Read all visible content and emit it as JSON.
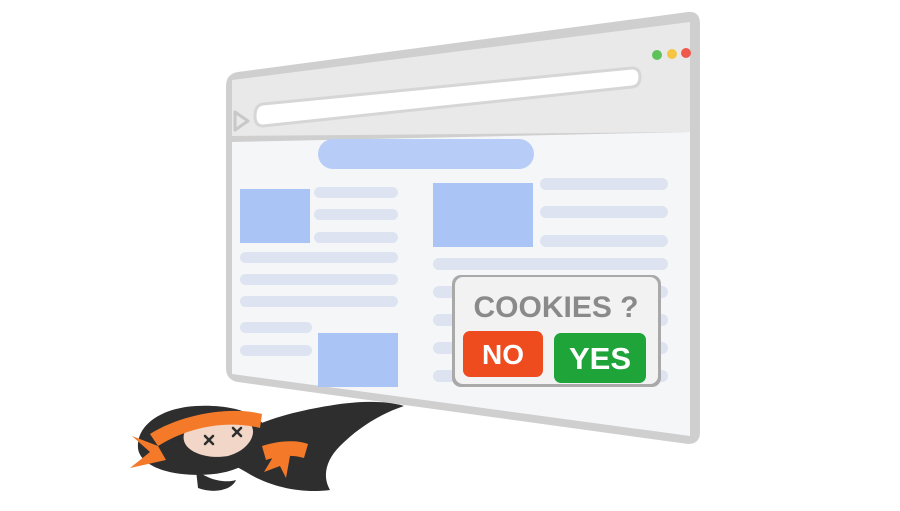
{
  "browser": {
    "window_controls": [
      "green",
      "yellow",
      "red"
    ],
    "control_colors": {
      "green": "#5ec25a",
      "yellow": "#f5c542",
      "red": "#ef5a4d"
    },
    "frame_color": "#cfcfcf",
    "content_color": "#f5f6f8",
    "accent_blue": "#b7cdf7",
    "line_color": "#dde3f0"
  },
  "cookie_dialog": {
    "title": "COOKIES ?",
    "no_label": "NO",
    "yes_label": "YES",
    "no_color": "#ee4b1f",
    "yes_color": "#1fa43a"
  },
  "mascot": {
    "icon": "knocked-out-ninja-icon",
    "band_color": "#f47a2a",
    "body_color": "#2e2e2e"
  }
}
